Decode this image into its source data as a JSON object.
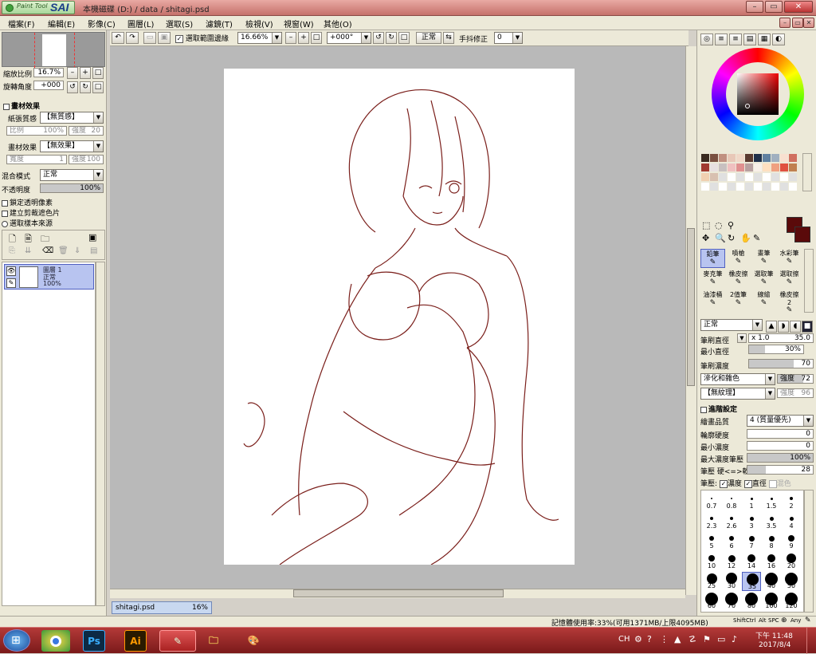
{
  "window": {
    "app_name": "SAI",
    "app_sub": "Paint Tool",
    "title": "本機磁碟 (D:) / data / shitagi.psd"
  },
  "menubar": [
    "檔案(F)",
    "編輯(E)",
    "影像(C)",
    "圖層(L)",
    "選取(S)",
    "濾鏡(T)",
    "檢視(V)",
    "視窗(W)",
    "其他(O)"
  ],
  "toolbar": {
    "select_edge_label": "選取範圍邊緣",
    "select_edge_checked": true,
    "zoom": "16.66%",
    "rotation": "+000°",
    "blend": "正常",
    "stabilizer_label": "手抖修正",
    "stabilizer_value": "0"
  },
  "navigator": {
    "zoom_label": "縮放比例",
    "zoom_value": "16.7%",
    "rotate_label": "旋轉角度",
    "rotate_value": "+000"
  },
  "paint_effect": {
    "section": "畫材效果",
    "paper_label": "紙張質感",
    "paper_value": "【無質感】",
    "scale_label": "比例",
    "scale_value": "100%",
    "strength_label": "強度",
    "strength_value": "20",
    "material_label": "畫材效果",
    "material_value": "【無效果】",
    "width_label": "寬度",
    "width_value": "1",
    "strength2_label": "強度",
    "strength2_value": "100"
  },
  "layer_props": {
    "blend_label": "混合模式",
    "blend_value": "正常",
    "opacity_label": "不透明度",
    "opacity_value": "100%",
    "options": [
      "鎖定透明像素",
      "建立剪裁遮色片",
      "選取樣本來源"
    ]
  },
  "layers": [
    {
      "name": "圖層 1",
      "mode": "正常",
      "opacity": "100%"
    }
  ],
  "document_tab": {
    "name": "shitagi.psd",
    "zoom": "16%"
  },
  "right_panel": {
    "brush_tools": [
      "鉛筆",
      "噴槍",
      "畫筆",
      "水彩筆",
      "麥克筆",
      "橡皮擦",
      "選取筆",
      "選取擦",
      "油漆桶",
      "2值筆",
      "線繪",
      "橡皮擦 2"
    ],
    "blend_mode": "正常",
    "brush_size_label": "筆刷直徑",
    "brush_size_mult": "x 1.0",
    "brush_size_value": "35.0",
    "min_size_label": "最小直徑",
    "min_size_value": "30%",
    "density_label": "筆刷濃度",
    "density_value": "70",
    "blend_shape": "滲化和雜色",
    "blend_strength_label": "強度",
    "blend_strength_value": "72",
    "texture": "【無紋理】",
    "texture_strength_label": "強度",
    "texture_strength_value": "96",
    "advanced_label": "進階設定",
    "quality_label": "繪畫品質",
    "quality_value": "4 (質量優先)",
    "hardness_label": "輪廓硬度",
    "hardness_value": "0",
    "min_density_label": "最小濃度",
    "min_density_value": "0",
    "max_pressure_label": "最大濃度筆壓",
    "max_pressure_value": "100%",
    "pressure_label": "筆壓 硬<=>軟",
    "pressure_value": "28",
    "pressure_opts_label": "筆壓:",
    "pressure_density": "濃度",
    "pressure_size": "直徑",
    "pressure_blend": "混色",
    "size_presets": [
      "0.7",
      "0.8",
      "1",
      "1.5",
      "2",
      "2.3",
      "2.6",
      "3",
      "3.5",
      "4",
      "5",
      "6",
      "7",
      "8",
      "9",
      "10",
      "12",
      "14",
      "16",
      "20",
      "25",
      "30",
      "35",
      "40",
      "50",
      "60",
      "70",
      "80",
      "100",
      "120"
    ]
  },
  "status": {
    "memory": "記憶體使用率:33%(可用1371MB/上限4095MB)",
    "keys": [
      "Shift",
      "Ctrl",
      "Alt",
      "SPC",
      "Any"
    ]
  },
  "taskbar": {
    "lang": "CH",
    "time": "下午 11:48",
    "date": "2017/8/4",
    "apps": [
      "Ps",
      "Ai"
    ]
  },
  "colors": {
    "current": "#5a0a0a",
    "accent": "#b43a38"
  }
}
